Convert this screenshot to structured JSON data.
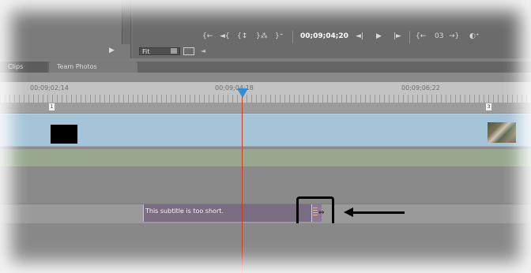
{
  "monitor": {
    "timecode": "00;09;04;20",
    "zoom_select": "Fit",
    "left_controls": [
      "{←",
      "◄{",
      "{↕",
      "}⁂",
      "}⁺"
    ],
    "transport": [
      "◄|",
      "▶",
      "|►"
    ],
    "right_controls": [
      "{←",
      "03",
      "→}",
      "◐⁺"
    ]
  },
  "project_panel": {
    "play_icon": "▶"
  },
  "timeline": {
    "tabs": [
      "Clips",
      "Team Photos"
    ],
    "ruler": {
      "tc_left": "00;09;02;14",
      "tc_mid": "00;09;04;18",
      "tc_right": "00;09;06;22"
    },
    "markers": {
      "left": "1",
      "right": "3"
    },
    "subtitle_clip": "This subtitle is too short."
  },
  "colors": {
    "accent": "#c77a1a",
    "playhead": "#2f8fd8",
    "playline": "#d63a22",
    "video_track": "#a6c4d8",
    "audio_track": "#97a88f",
    "subtitle_clip": "#7a6c82"
  },
  "icons": [
    "play-icon",
    "playhead-icon",
    "marker-icon",
    "arrow-icon",
    "cursor-icon"
  ]
}
